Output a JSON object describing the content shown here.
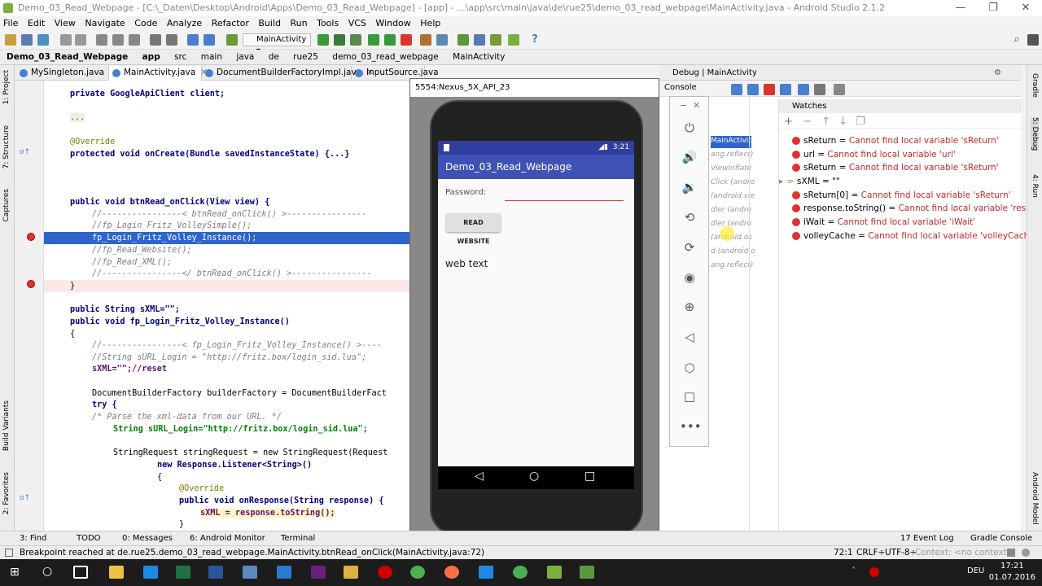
{
  "window": {
    "title": "Demo_03_Read_Webpage - [C:\\_Daten\\Desktop\\Android\\Apps\\Demo_03_Read_Webpage] - [app] - ...\\app\\src\\main\\java\\de\\rue25\\demo_03_read_webpage\\MainActivity.java - Android Studio 2.1.2"
  },
  "menu": [
    "File",
    "Edit",
    "View",
    "Navigate",
    "Code",
    "Analyze",
    "Refactor",
    "Build",
    "Run",
    "Tools",
    "VCS",
    "Window",
    "Help"
  ],
  "toolbar": {
    "run_config": "MainActivity"
  },
  "breadcrumb": [
    "Demo_03_Read_Webpage",
    "app",
    "src",
    "main",
    "java",
    "de",
    "rue25",
    "demo_03_read_webpage",
    "MainActivity"
  ],
  "left_tools": [
    "1: Project",
    "7: Structure",
    "Captures",
    "Build Variants",
    "2: Favorites"
  ],
  "right_tools": [
    "Gradle",
    "5: Debug",
    "4: Run",
    "Android Model"
  ],
  "editor_tabs": [
    "MySingleton.java",
    "MainActivity.java",
    "DocumentBuilderFactoryImpl.java",
    "InputSource.java"
  ],
  "code": {
    "l01": "private GoogleApiClient client;",
    "l02": "...",
    "l03": "@Override",
    "l04": "protected void onCreate(Bundle savedInstanceState) {...}",
    "l05": "public void btnRead_onClick(View view) {",
    "l06": "//----------------< btnRead_onClick() >----------------",
    "l07": "//fp_Login_Fritz_VolleySimple();",
    "l08": "fp_Login_Fritz_Volley_Instance();",
    "l09": "//fp_Read_Website();",
    "l10": "//fp_Read_XML();",
    "l11": "//----------------</ btnRead_onClick() >----------------",
    "l12": "}",
    "l13": "public String sXML=\"\";",
    "l14": "public void fp_Login_Fritz_Volley_Instance()",
    "l15": "{",
    "l16": "//----------------< fp_Login_Fritz_Volley_Instance() >----",
    "l17": "//String sURL_Login = \"http://fritz.box/login_sid.lua\";",
    "l18": "sXML=\"\";//reset",
    "l19": "DocumentBuilderFactory builderFactory = DocumentBuilderFact",
    "l20": "try {",
    "l21": "/* Parse the xml-data from our URL. */",
    "l22": "String sURL_Login=\"http://fritz.box/login_sid.lua\";",
    "l23": "StringRequest stringRequest = new StringRequest(Request",
    "l24": "new Response.Listener<String>()",
    "l25": "{",
    "l26": "@Override",
    "l27": "public void onResponse(String response) {",
    "l28": "sXML = response.toString();",
    "l29": "}"
  },
  "emulator": {
    "window_title": "5554:Nexus_5X_API_23",
    "time": "3:21",
    "app_title": "Demo_03_Read_Webpage",
    "password_label": "Password:",
    "button_label": "READ WEBSITE",
    "output_text": "web text"
  },
  "debug": {
    "title": "Debug",
    "config": "MainActivity",
    "console_tab": "Console",
    "watches_title": "Watches",
    "frames": [
      "MainActivity (de",
      "ang.reflect)",
      "ViewInflate",
      "Click (andro",
      "(android.vie",
      "dler (andro",
      "dler (andro",
      "(android.os",
      "d (android.o",
      "ang.reflect)"
    ],
    "watches": [
      {
        "name": "sReturn",
        "value": "Cannot find local variable 'sReturn'"
      },
      {
        "name": "url",
        "value": "Cannot find local variable 'url'"
      },
      {
        "name": "sReturn",
        "value": "Cannot find local variable 'sReturn'"
      },
      {
        "name": "sXML",
        "value": "\"\""
      },
      {
        "name": "sReturn[0]",
        "value": "Cannot find local variable 'sReturn'"
      },
      {
        "name": "response.toString()",
        "value": "Cannot find local variable 'response'"
      },
      {
        "name": "iWait",
        "value": "Cannot find local variable 'iWait'"
      },
      {
        "name": "volleyCache",
        "value": "Cannot find local variable 'volleyCache'"
      }
    ]
  },
  "bottom_tabs": [
    "3: Find",
    "TODO",
    "0: Messages",
    "6: Android Monitor",
    "Terminal",
    "17 Event Log",
    "Gradle Console"
  ],
  "status": {
    "message": "Breakpoint reached at de.rue25.demo_03_read_webpage.MainActivity.btnRead_onClick(MainActivity.java:72)",
    "position": "72:1",
    "line_sep": "CRLF÷",
    "encoding": "UTF-8÷",
    "context": "Context: <no context>"
  },
  "taskbar": {
    "lang": "DEU",
    "time": "17:21",
    "date": "01.07.2016"
  },
  "colors": {
    "accent": "#3f51b5",
    "selection": "#2f65ca",
    "error": "#c62828"
  }
}
